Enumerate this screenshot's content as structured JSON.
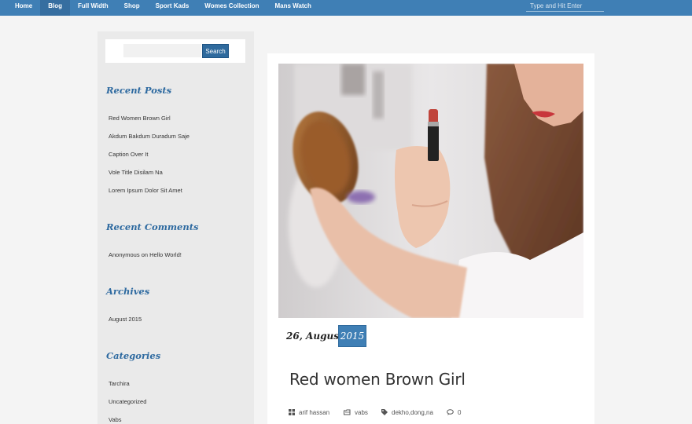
{
  "nav": {
    "items": [
      {
        "label": "Home",
        "active": false
      },
      {
        "label": "Blog",
        "active": true
      },
      {
        "label": "Full Width",
        "active": false
      },
      {
        "label": "Shop",
        "active": false
      },
      {
        "label": "Sport Kads",
        "active": false
      },
      {
        "label": "Womes Collection",
        "active": false
      },
      {
        "label": "Mans Watch",
        "active": false
      }
    ],
    "search_placeholder": "Type and Hit Enter"
  },
  "sidebar": {
    "search": {
      "placeholder": "",
      "button_label": "Search"
    },
    "recent_posts": {
      "title": "Recent Posts",
      "items": [
        "Red Women Brown Girl",
        "Akdum Bakdum Duradum Saje",
        "Caption Over It",
        "Vole Title Disilam Na",
        "Lorem Ipsum Dolor Sit Amet"
      ]
    },
    "recent_comments": {
      "title": "Recent Comments",
      "author": "Anonymous",
      "connector": "on",
      "post": "Hello World!"
    },
    "archives": {
      "title": "Archives",
      "items": [
        "August 2015"
      ]
    },
    "categories": {
      "title": "Categories",
      "items": [
        "Tarchira",
        "Uncategorized",
        "Vabs"
      ]
    }
  },
  "post": {
    "date_day": "26, August",
    "date_year": "2015",
    "title": "Red women Brown Girl",
    "meta": {
      "author": "arif hassan",
      "category": "vabs",
      "tags": "dekho,dong,na",
      "comments": "0"
    }
  },
  "colors": {
    "accent": "#3f7fb5",
    "accent_dark": "#2f6a9d",
    "nav_active": "#366ea0"
  },
  "icons": {
    "author": "grid-icon",
    "category": "folder-icon",
    "tags": "tag-icon",
    "comments": "comment-icon"
  }
}
